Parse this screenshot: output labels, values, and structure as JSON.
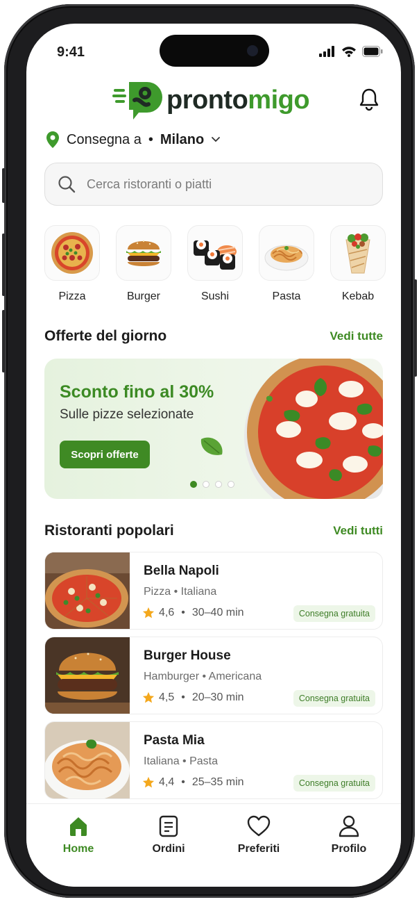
{
  "status_bar": {
    "time": "9:41"
  },
  "brand": {
    "name_part1": "pronto",
    "name_part2": "migo",
    "green": "#3e9a2c",
    "dark": "#1f2a24"
  },
  "delivery": {
    "prefix": "Consegna a",
    "separator": "•",
    "city": "Milano"
  },
  "search": {
    "placeholder": "Cerca ristoranti o piatti"
  },
  "categories": [
    {
      "label": "Pizza",
      "icon": "pizza-icon"
    },
    {
      "label": "Burger",
      "icon": "burger-icon"
    },
    {
      "label": "Sushi",
      "icon": "sushi-icon"
    },
    {
      "label": "Pasta",
      "icon": "pasta-icon"
    },
    {
      "label": "Kebab",
      "icon": "kebab-icon"
    }
  ],
  "offers": {
    "title": "Offerte del giorno",
    "link": "Vedi tutte",
    "banner": {
      "headline": "Sconto fino al 30%",
      "subtitle": "Sulle pizze selezionate",
      "cta": "Scopri offerte",
      "slides": 4,
      "active_slide": 1
    }
  },
  "restaurants": {
    "title": "Ristoranti popolari",
    "link": "Vedi tutti",
    "items": [
      {
        "name": "Bella Napoli",
        "tags": "Pizza • Italiana",
        "rating": "4,6",
        "time": "30–40 min",
        "badge": "Consegna gratuita"
      },
      {
        "name": "Burger House",
        "tags": "Hamburger • Americana",
        "rating": "4,5",
        "time": "20–30 min",
        "badge": "Consegna gratuita"
      },
      {
        "name": "Pasta Mia",
        "tags": "Italiana • Pasta",
        "rating": "4,4",
        "time": "25–35 min",
        "badge": "Consegna gratuita"
      }
    ]
  },
  "tabbar": [
    {
      "label": "Home",
      "icon": "home-icon",
      "active": true
    },
    {
      "label": "Ordini",
      "icon": "orders-icon",
      "active": false
    },
    {
      "label": "Preferiti",
      "icon": "heart-icon",
      "active": false
    },
    {
      "label": "Profilo",
      "icon": "user-icon",
      "active": false
    }
  ],
  "colors": {
    "accent": "#3e8a23",
    "star": "#f4a81d",
    "badge_bg": "#edf6e8"
  }
}
